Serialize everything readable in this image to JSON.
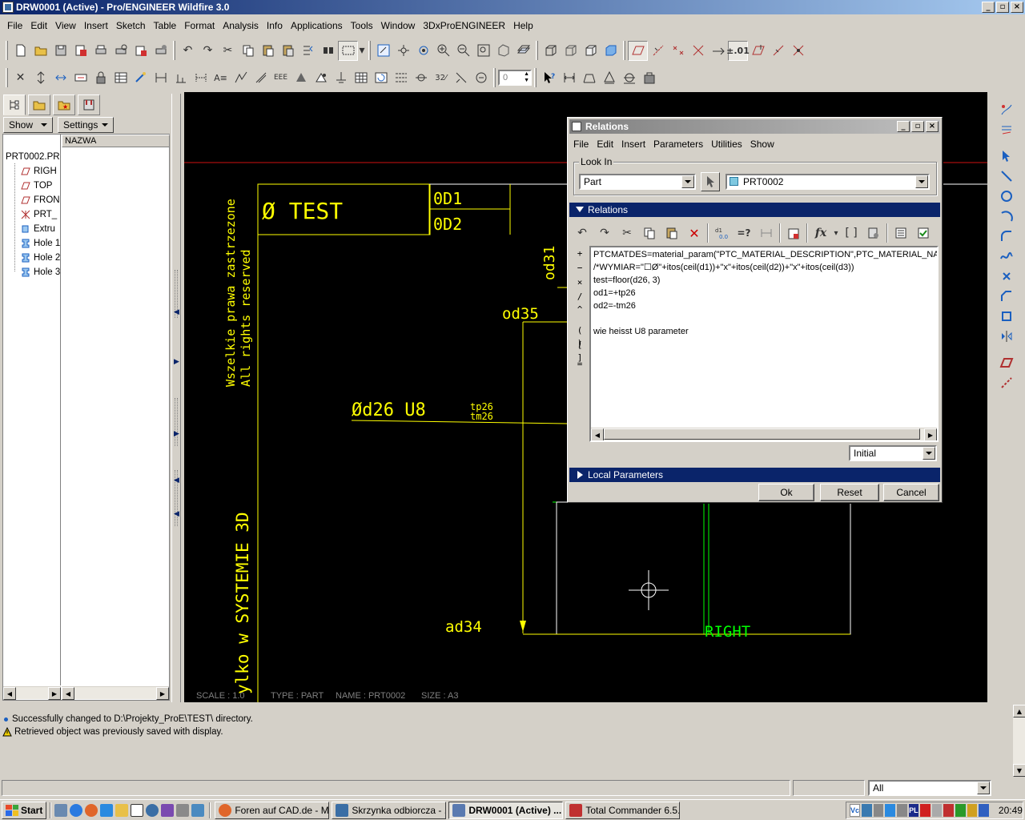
{
  "window": {
    "title": "DRW0001 (Active) - Pro/ENGINEER Wildfire 3.0",
    "controls": [
      "_",
      "▫",
      "×"
    ]
  },
  "menubar": [
    "File",
    "Edit",
    "View",
    "Insert",
    "Sketch",
    "Table",
    "Format",
    "Analysis",
    "Info",
    "Applications",
    "Tools",
    "Window",
    "3DxProENGINEER",
    "Help"
  ],
  "toolbar": {
    "spin_value": "0",
    "tolerance_label": "±.01"
  },
  "navigator": {
    "show_label": "Show",
    "settings_label": "Settings",
    "column_header": "NAZWA",
    "tree": [
      {
        "label": "PRT0002.PR",
        "icon": "part-icon"
      },
      {
        "label": "RIGH",
        "icon": "datum-plane-icon"
      },
      {
        "label": "TOP",
        "icon": "datum-plane-icon"
      },
      {
        "label": "FRON",
        "icon": "datum-plane-icon"
      },
      {
        "label": "PRT_",
        "icon": "coordinate-system-icon"
      },
      {
        "label": "Extru",
        "icon": "extrude-icon"
      },
      {
        "label": "Hole 1",
        "icon": "hole-icon"
      },
      {
        "label": "Hole 2",
        "icon": "hole-icon"
      },
      {
        "label": "Hole 3",
        "icon": "hole-icon"
      }
    ]
  },
  "drawing": {
    "title_cell": "Ø TEST",
    "od1": "0D1",
    "od2": "0D2",
    "side_text_1": "Wszelkie prawa zastrzezone",
    "side_text_2": "All rights reserved",
    "od31": "od31",
    "od35": "od35",
    "dim_d26": "Ød26 U8",
    "tp26": "tp26",
    "tm26": "tm26",
    "ad34": "ad34",
    "right_label": "RIGHT",
    "system_text": "ylko w SYSTEMIE 3D",
    "footer_scale": "SCALE : 1.0",
    "footer_type": "TYPE : PART",
    "footer_name": "NAME : PRT0002",
    "footer_size": "SIZE : A3",
    "colors": {
      "yellow": "#ffff00",
      "green": "#00ff00",
      "red": "#ff0000",
      "white": "#ffffff",
      "gray": "#808080"
    }
  },
  "relations_dialog": {
    "title": "Relations",
    "menu": [
      "File",
      "Edit",
      "Insert",
      "Parameters",
      "Utilities",
      "Show"
    ],
    "look_in_label": "Look In",
    "look_in_type": "Part",
    "look_in_object": "PRT0002",
    "relations_section": "Relations",
    "lines": [
      "PTCMATDES=material_param(\"PTC_MATERIAL_DESCRIPTION\",PTC_MATERIAL_NAM",
      "/*WYMIAR=\"☐Ø\"+itos(ceil(d1))+\"x\"+itos(ceil(d2))+\"x\"+itos(ceil(d3))",
      "test=floor(d26, 3)",
      "od1=+tp26",
      "od2=-tm26",
      "",
      "wie heisst U8 parameter"
    ],
    "side_keys": [
      "+",
      "−",
      "×",
      "/",
      "^",
      "( )",
      "[ ]",
      "="
    ],
    "sort_option": "Initial",
    "local_params_section": "Local Parameters",
    "ok_label": "Ok",
    "reset_label": "Reset",
    "cancel_label": "Cancel"
  },
  "messages": [
    {
      "icon": "info-bullet-icon",
      "text": "Successfully changed to D:\\Projekty_ProE\\TEST\\ directory."
    },
    {
      "icon": "warning-icon",
      "text": "Retrieved object was previously saved with display."
    }
  ],
  "status": {
    "filter_value": "All"
  },
  "taskbar": {
    "start_label": "Start",
    "tasks": [
      {
        "label": "Foren auf CAD.de - M...",
        "active": false,
        "color": "#e0662a"
      },
      {
        "label": "Skrzynka odbiorcza - ...",
        "active": false,
        "color": "#3a6ea5"
      },
      {
        "label": "DRW0001 (Active) ...",
        "active": true,
        "color": "#5a7ab0"
      },
      {
        "label": "Total Commander 6.5...",
        "active": false,
        "color": "#c03030"
      }
    ],
    "tray_icons": [
      "Vc",
      "PL"
    ],
    "clock": "20:49"
  }
}
